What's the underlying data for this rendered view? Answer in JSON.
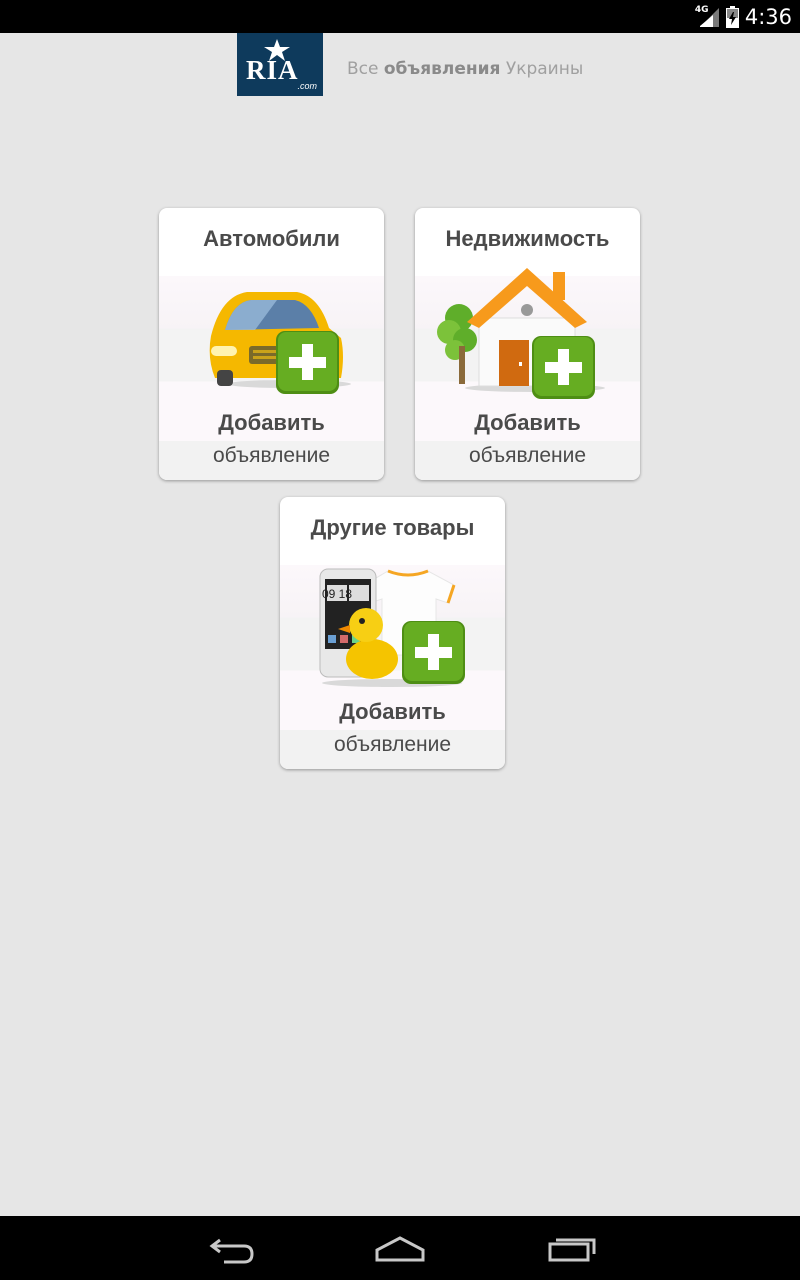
{
  "status_bar": {
    "network_type": "4G",
    "time": "4:36",
    "signal_icon": "signal-icon",
    "battery_icon": "battery-charging-icon"
  },
  "header": {
    "logo_text": "RIA",
    "logo_domain": ".com",
    "tagline_prefix": "Все ",
    "tagline_bold": "объявления",
    "tagline_suffix": " Украины",
    "logo_color": "#0e3a5c"
  },
  "categories": [
    {
      "title": "Автомобили",
      "icon": "car-add-icon",
      "action": "Добавить",
      "action_sub": "объявление"
    },
    {
      "title": "Недвижимость",
      "icon": "house-add-icon",
      "action": "Добавить",
      "action_sub": "объявление"
    },
    {
      "title": "Другие товары",
      "icon": "goods-add-icon",
      "action": "Добавить",
      "action_sub": "объявление",
      "phone_clock": "09 18"
    }
  ],
  "nav_bar": {
    "back": "back-icon",
    "home": "home-icon",
    "recents": "recents-icon"
  },
  "colors": {
    "accent_green": "#5fa51c",
    "car_yellow": "#f5b800",
    "roof_orange": "#f79a1c",
    "text": "#4a4a4a"
  }
}
